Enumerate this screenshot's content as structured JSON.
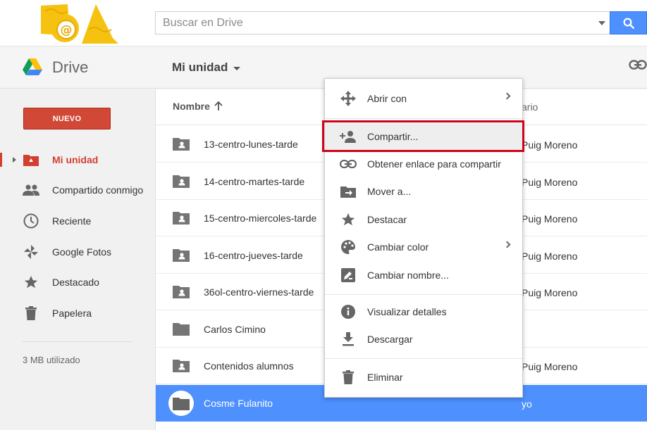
{
  "search": {
    "placeholder": "Buscar en Drive"
  },
  "app": {
    "title": "Drive",
    "folder": "Mi unidad",
    "new_button": "NUEVO"
  },
  "sidebar": {
    "items": [
      {
        "label": "Mi unidad",
        "icon": "my-drive-icon"
      },
      {
        "label": "Compartido conmigo",
        "icon": "shared-people-icon"
      },
      {
        "label": "Reciente",
        "icon": "clock-icon"
      },
      {
        "label": "Google Fotos",
        "icon": "photos-pinwheel-icon"
      },
      {
        "label": "Destacado",
        "icon": "star-icon"
      },
      {
        "label": "Papelera",
        "icon": "trash-icon"
      }
    ],
    "storage": "3 MB utilizado"
  },
  "list": {
    "columns": {
      "name": "Nombre",
      "owner_partial": "ario"
    },
    "rows": [
      {
        "name": "13-centro-lunes-tarde",
        "owner": "Puig Moreno",
        "shared": true
      },
      {
        "name": "14-centro-martes-tarde",
        "owner": "Puig Moreno",
        "shared": true
      },
      {
        "name": "15-centro-miercoles-tarde",
        "owner": "Puig Moreno",
        "shared": true
      },
      {
        "name": "16-centro-jueves-tarde",
        "owner": "Puig Moreno",
        "shared": true
      },
      {
        "name": "36ol-centro-viernes-tarde",
        "owner": "Puig Moreno",
        "shared": true
      },
      {
        "name": "Carlos Cimino",
        "owner": "",
        "shared": false
      },
      {
        "name": "Contenidos alumnos",
        "owner": "Puig Moreno",
        "shared": true
      },
      {
        "name": "Cosme Fulanito",
        "owner": "yo",
        "shared": false,
        "selected": true
      }
    ]
  },
  "context_menu": {
    "items": [
      {
        "label": "Abrir con",
        "icon": "move-arrows-icon",
        "submenu": true
      },
      {
        "label": "Compartir...",
        "icon": "person-add-icon",
        "highlighted": true
      },
      {
        "label": "Obtener enlace para compartir",
        "icon": "link-icon"
      },
      {
        "label": "Mover a...",
        "icon": "move-to-folder-icon"
      },
      {
        "label": "Destacar",
        "icon": "star-icon"
      },
      {
        "label": "Cambiar color",
        "icon": "palette-icon",
        "submenu": true
      },
      {
        "label": "Cambiar nombre...",
        "icon": "rename-pencil-icon"
      },
      {
        "label": "Visualizar detalles",
        "icon": "info-icon"
      },
      {
        "label": "Descargar",
        "icon": "download-icon"
      },
      {
        "label": "Eliminar",
        "icon": "trash-icon"
      }
    ]
  },
  "colors": {
    "accent_blue": "#4d90fe",
    "new_red": "#d14836",
    "active_red": "#d23f31",
    "highlight_box": "#d0021b"
  }
}
